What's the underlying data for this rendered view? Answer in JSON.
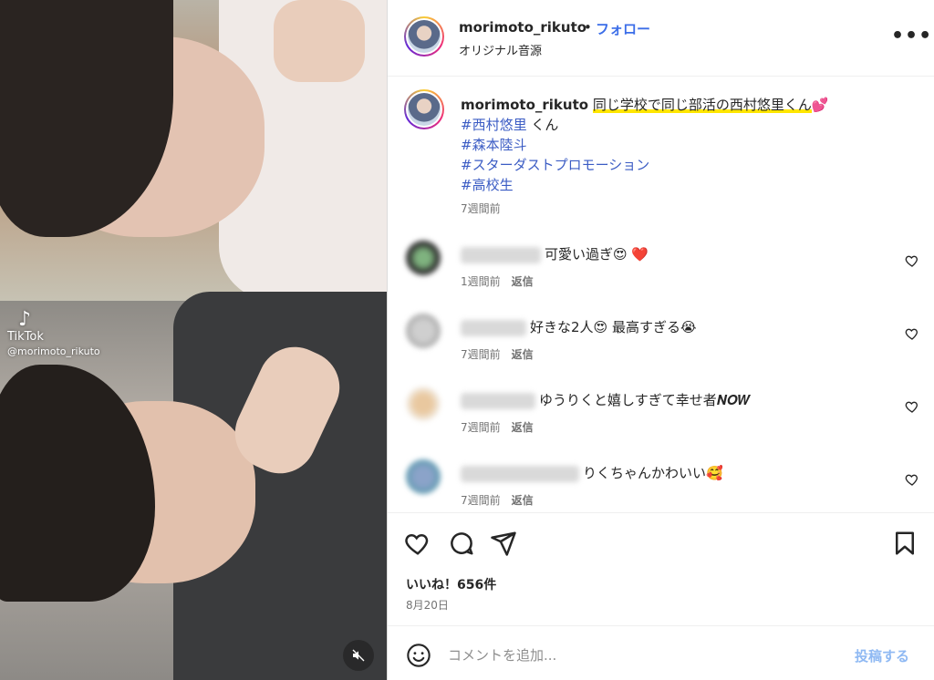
{
  "media": {
    "watermark_app": "TikTok",
    "watermark_handle": "@morimoto_rikuto"
  },
  "header": {
    "username": "morimoto_rikuto",
    "separator": "•",
    "follow_label": "フォロー",
    "audio_label": "オリジナル音源",
    "more_label": "•••"
  },
  "caption": {
    "username": "morimoto_rikuto",
    "highlight_text": "同じ学校で同じ部活の西村悠里くん",
    "emoji": "💕",
    "tag1": "#西村悠里",
    "tag1_suffix": " くん",
    "tag2": "#森本陸斗",
    "tag3": "#スターダストプロモーション",
    "tag4": "#高校生",
    "time": "7週間前"
  },
  "comments": [
    {
      "text": "可愛い過ぎ😍 ❤️",
      "time": "1週間前",
      "reply": "返信"
    },
    {
      "text": "好きな2人😍 最高すぎる😭",
      "time": "7週間前",
      "reply": "返信"
    },
    {
      "text": "ゆうりくと嬉しすぎて幸せ者𝑵𝑶𝑾",
      "time": "7週間前",
      "reply": "返信"
    },
    {
      "text": "りくちゃんかわいい🥰",
      "time": "7週間前",
      "reply": "返信"
    }
  ],
  "actions": {
    "likes": "いいね！656件",
    "date": "8月20日"
  },
  "composer": {
    "placeholder": "コメントを追加...",
    "post_label": "投稿する"
  },
  "colors": {
    "link_blue": "#3c6ee8",
    "highlight_yellow": "#ffe600",
    "post_disabled": "#8fb9f3"
  }
}
